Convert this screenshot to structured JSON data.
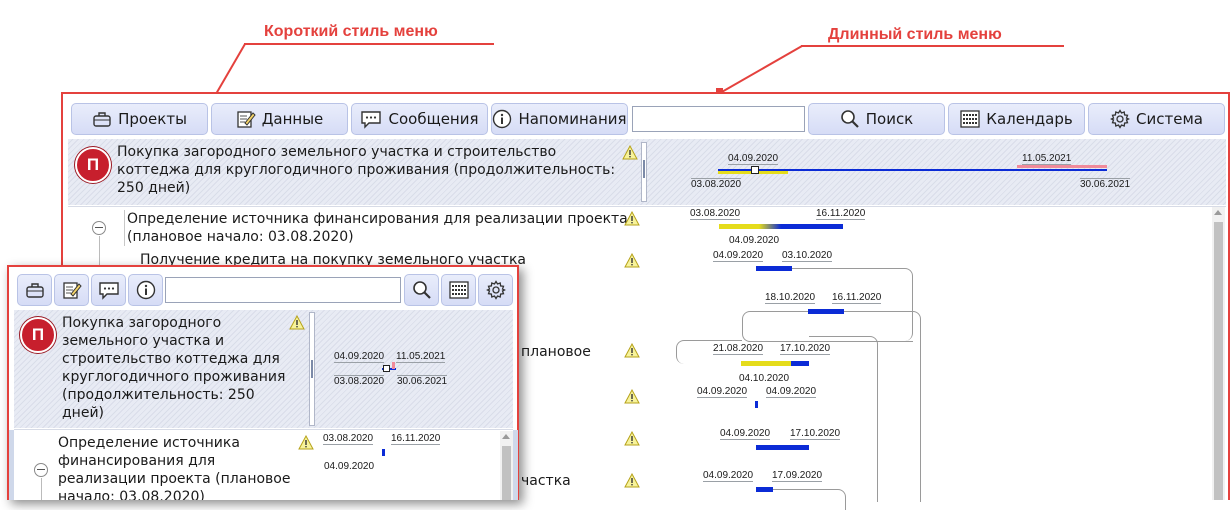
{
  "callouts": {
    "short": "Короткий стиль меню",
    "long": "Длинный стиль меню"
  },
  "toolbar": {
    "projects": "Проекты",
    "data": "Данные",
    "messages": "Сообщения",
    "reminders": "Напоминания",
    "search": "Поиск",
    "calendar": "Календарь",
    "system": "Система",
    "search_value": ""
  },
  "project": {
    "badge": "П",
    "title": "Покупка загородного земельного участка и строительство коттеджа для круглогодичного проживания (продолжительность: 250 дней)",
    "dates": {
      "top_left": "04.09.2020",
      "top_right": "11.05.2021",
      "bottom_left": "03.08.2020",
      "bottom_right": "30.06.2021"
    }
  },
  "tasks": [
    {
      "title": "Определение источника финансирования для реализации проекта (плановое начало: 03.08.2020)"
    },
    {
      "title": "Получение кредита на покупку земельного участка"
    },
    {
      "title_fragment": "плановое"
    },
    {
      "title_fragment": "частка"
    }
  ],
  "gantt": {
    "row1": {
      "start": "03.08.2020",
      "end": "16.11.2020",
      "marker": "04.09.2020"
    },
    "row2": {
      "start": "04.09.2020",
      "end": "03.10.2020"
    },
    "row3": {
      "start": "18.10.2020",
      "end": "16.11.2020"
    },
    "row4": {
      "start": "21.08.2020",
      "end": "17.10.2020",
      "marker": "04.10.2020"
    },
    "row5": {
      "start": "04.09.2020",
      "end": "04.09.2020"
    },
    "row6": {
      "start": "04.09.2020",
      "end": "17.10.2020"
    },
    "row7": {
      "start": "04.09.2020",
      "end": "17.09.2020"
    }
  },
  "colors": {
    "accent_red": "#e4413d",
    "bar_blue": "#0b2bd6",
    "bar_yellow": "#e5dc1b",
    "badge_red": "#c71f2d"
  }
}
